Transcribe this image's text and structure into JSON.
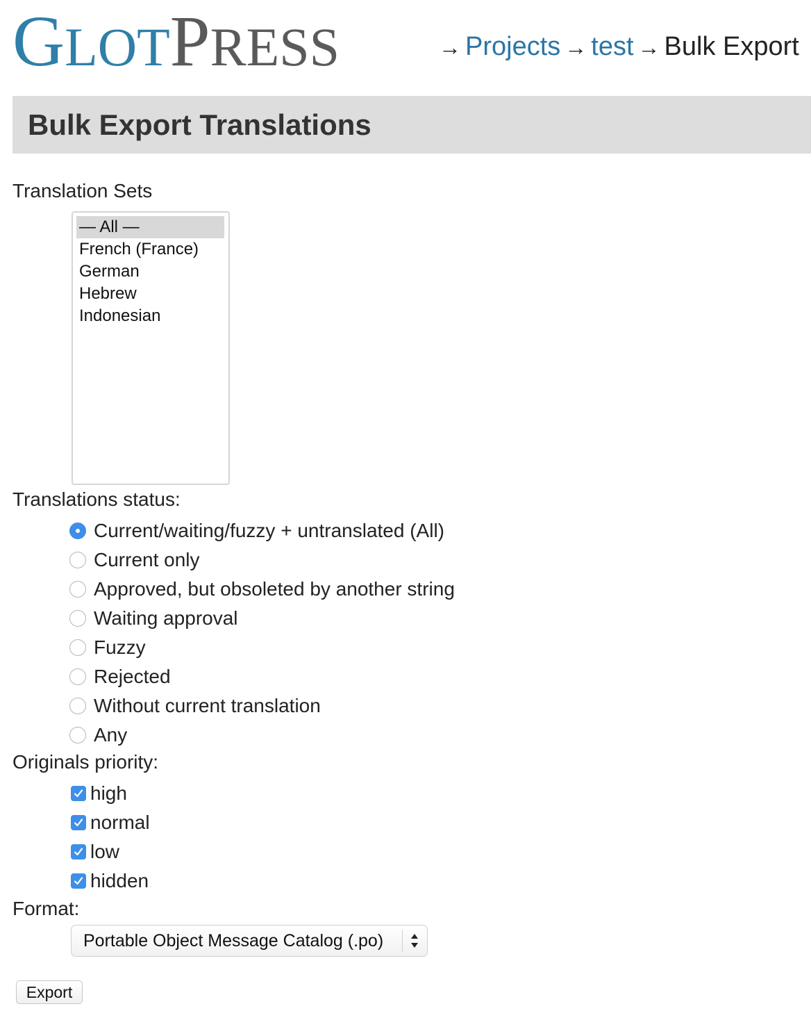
{
  "header": {
    "logo_text": "GlotPress",
    "breadcrumb": [
      {
        "label": "Projects",
        "link": true
      },
      {
        "label": "test",
        "link": true
      },
      {
        "label": "Bulk Export",
        "link": false
      }
    ],
    "separator": "→"
  },
  "page_title": "Bulk Export Translations",
  "translation_sets": {
    "label": "Translation Sets",
    "options": [
      "— All —",
      "French (France)",
      "German",
      "Hebrew",
      "Indonesian"
    ],
    "selected_index": 0
  },
  "status": {
    "label": "Translations status:",
    "options": [
      "Current/waiting/fuzzy + untranslated (All)",
      "Current only",
      "Approved, but obsoleted by another string",
      "Waiting approval",
      "Fuzzy",
      "Rejected",
      "Without current translation",
      "Any"
    ],
    "selected_index": 0
  },
  "priority": {
    "label": "Originals priority:",
    "options": [
      {
        "label": "high",
        "checked": true
      },
      {
        "label": "normal",
        "checked": true
      },
      {
        "label": "low",
        "checked": true
      },
      {
        "label": "hidden",
        "checked": true
      }
    ]
  },
  "format": {
    "label": "Format:",
    "value": "Portable Object Message Catalog (.po)"
  },
  "export_button": "Export",
  "colors": {
    "link": "#2b76a7",
    "accent": "#3d8fe8",
    "title_bar": "#dddddd",
    "logo_glot": "#2f7fa8",
    "logo_press": "#5a5a5a"
  }
}
